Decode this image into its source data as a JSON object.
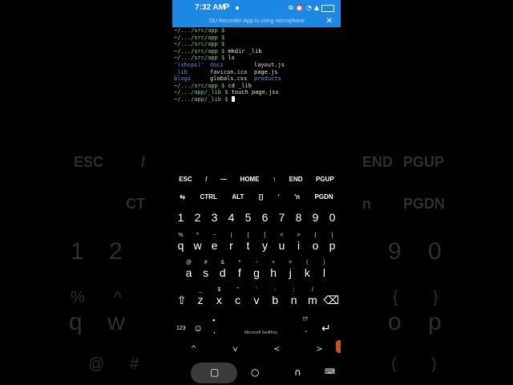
{
  "status_bar": {
    "time": "7:32 AM",
    "app_letter": "P"
  },
  "notification": {
    "text": "DU Recorder App is using microphone",
    "close": "✕"
  },
  "terminal": {
    "lines": [
      {
        "prompt": "~/.../src/app $",
        "cmd": ""
      },
      {
        "prompt": "~/.../src/app $",
        "cmd": ""
      },
      {
        "prompt": "~/.../src/app $",
        "cmd": ""
      },
      {
        "prompt": "~/.../src/app $",
        "cmd": " mkdir _lib"
      },
      {
        "prompt": "~/.../src/app $",
        "cmd": " ls"
      }
    ],
    "ls_rows": [
      [
        "'(shops)'",
        "docs",
        "layout.js"
      ],
      [
        "_lib",
        "favicon.ico",
        "page.js"
      ],
      [
        "blogs",
        "globals.css",
        "products"
      ]
    ],
    "after": [
      {
        "prompt": "~/.../src/app $",
        "cmd": " cd _lib"
      },
      {
        "prompt": "~/.../app/_lib $",
        "cmd": " touch page.jsx"
      },
      {
        "prompt": "~/.../app/_lib $",
        "cmd": " "
      }
    ]
  },
  "keyboard": {
    "extra_row1": [
      "ESC",
      "/",
      "—",
      "HOME",
      "↑",
      "END",
      "PGUP"
    ],
    "extra_row2": [
      "⇆",
      "CTRL",
      "ALT",
      "[]",
      "'",
      "'n",
      "PGDN"
    ],
    "numbers": [
      "1",
      "2",
      "3",
      "4",
      "5",
      "6",
      "7",
      "8",
      "9",
      "0"
    ],
    "row_q": {
      "hints": [
        "%",
        "^",
        "~",
        "|",
        "[",
        "]",
        "<",
        ">",
        "{",
        "}"
      ],
      "keys": [
        "q",
        "w",
        "e",
        "r",
        "t",
        "y",
        "u",
        "i",
        "o",
        "p"
      ]
    },
    "row_a": {
      "hints": [
        "@",
        "#",
        "&",
        "*",
        "-",
        "+",
        "=",
        "(",
        ")"
      ],
      "keys": [
        "a",
        "s",
        "d",
        "f",
        "g",
        "h",
        "j",
        "k",
        "l"
      ]
    },
    "row_z": {
      "hints": [
        "_",
        "$",
        "\"",
        "'",
        ":",
        ";",
        "/"
      ],
      "keys": [
        "z",
        "x",
        "c",
        "v",
        "b",
        "n",
        "m"
      ]
    },
    "shift_icon": "⇧",
    "backspace_icon": "⌫",
    "num_toggle": "123",
    "emoji_icon": "☺",
    "mic_icon": "●",
    "comma": ",",
    "space_label": "Microsoft SwiftKey",
    "punct_hint": "!?",
    "period": ".",
    "enter_icon": "↵",
    "arrows": [
      "^",
      "v",
      "<",
      ">"
    ]
  },
  "navbar": {
    "recents_icon": "▢",
    "home_icon": "○",
    "back_icon": "∩",
    "keyboard_icon": "⌨"
  },
  "background": {
    "keys_row1": [
      "ESC",
      "/",
      "END",
      "PGUP"
    ],
    "keys_row2": [
      "CT",
      "n",
      "PGDN"
    ],
    "numbers": [
      "1",
      "2",
      "9",
      "0"
    ],
    "symbols": [
      "%",
      "^",
      "{",
      "}"
    ],
    "letters": [
      "q",
      "w",
      "o",
      "p"
    ],
    "bottom": [
      "@",
      "#",
      "(",
      ")"
    ]
  }
}
